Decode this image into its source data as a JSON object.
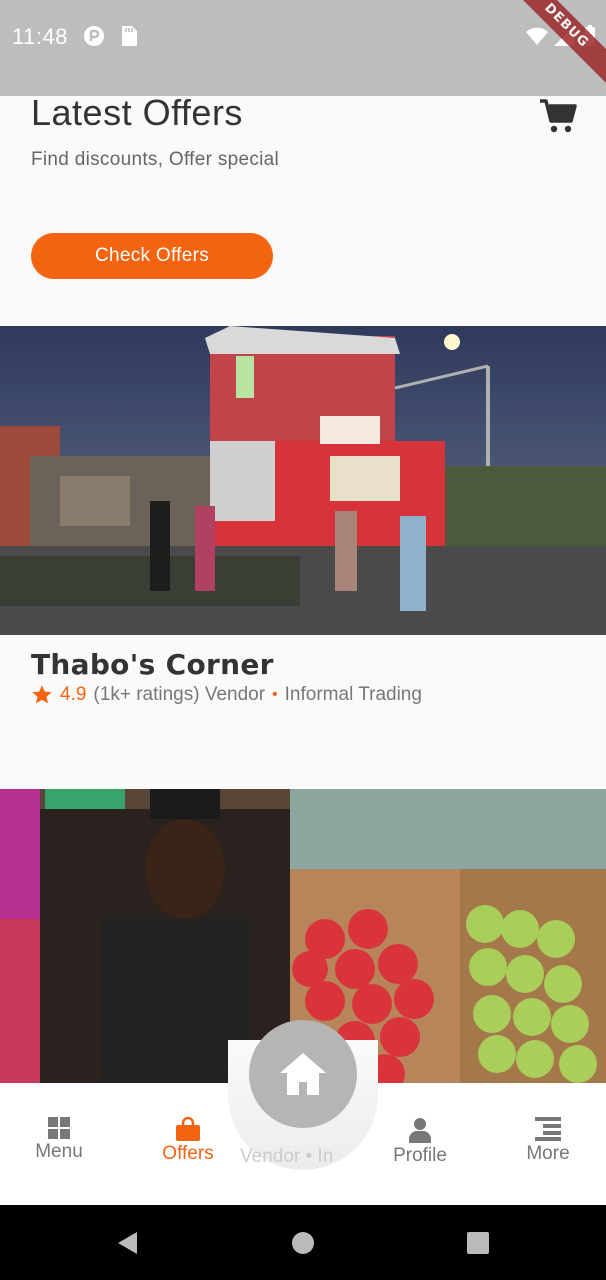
{
  "status_bar": {
    "time": "11:48",
    "debug_banner": "DEBUG",
    "icons": [
      "notification-icon",
      "sd-card-icon",
      "wifi-icon",
      "signal-icon",
      "battery-icon"
    ]
  },
  "header": {
    "title": "Latest Offers",
    "subtitle": "Find discounts, Offer special",
    "cart_icon": "cart-icon",
    "cta_label": "Check Offers"
  },
  "offers": [
    {
      "name": "Thabo's Corner",
      "rating": "4.9",
      "ratings_count": "(1k+ ratings) Vendor",
      "category": "Informal Trading",
      "image": "street-spaza-shop-photo"
    },
    {
      "image": "vendor-fruit-stall-photo",
      "ghost_text": "Vendor • In"
    }
  ],
  "bottom_nav": {
    "items": [
      {
        "label": "Menu",
        "icon": "grid-icon"
      },
      {
        "label": "Offers",
        "icon": "shopping-bag-icon",
        "active": true
      },
      {
        "label": "Profile",
        "icon": "person-icon"
      },
      {
        "label": "More",
        "icon": "list-icon"
      }
    ],
    "home_icon": "home-icon"
  },
  "colors": {
    "accent": "#f4630f",
    "statusbar": "#bdbdbd",
    "text_dark": "#333333",
    "text_muted": "#777777"
  }
}
